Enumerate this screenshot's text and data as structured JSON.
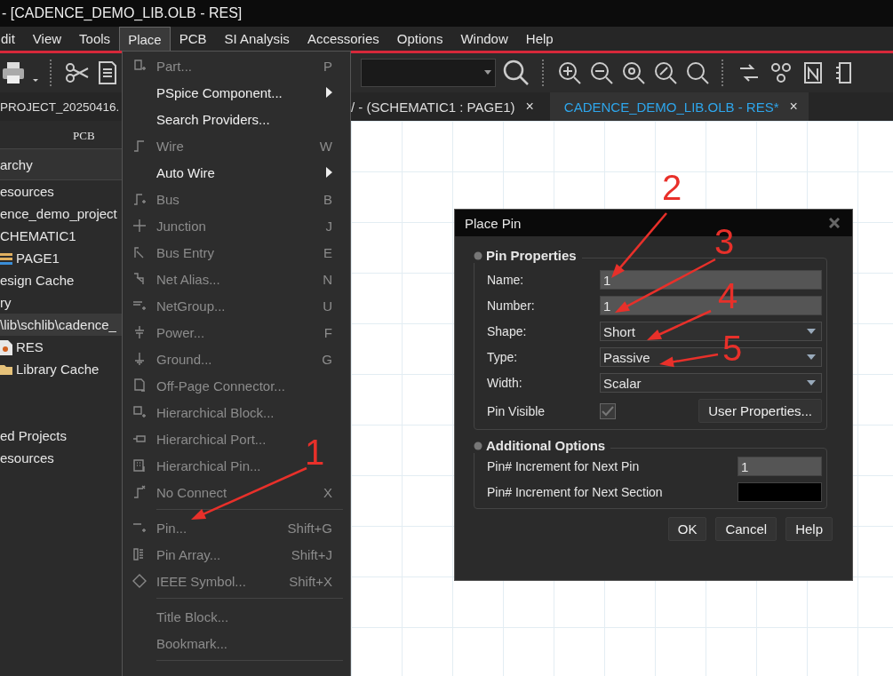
{
  "window": {
    "title": "- [CADENCE_DEMO_LIB.OLB - RES]"
  },
  "menu_bar": [
    {
      "label": "dit",
      "selected": false
    },
    {
      "label": "View",
      "selected": false
    },
    {
      "label": "Tools",
      "selected": false
    },
    {
      "label": "Place",
      "selected": true
    },
    {
      "label": "PCB",
      "selected": false
    },
    {
      "label": "SI Analysis",
      "selected": false
    },
    {
      "label": "Accessories",
      "selected": false
    },
    {
      "label": "Options",
      "selected": false
    },
    {
      "label": "Window",
      "selected": false
    },
    {
      "label": "Help",
      "selected": false
    }
  ],
  "tabs": [
    {
      "label": "PROJECT_20250416.",
      "selected": false
    },
    {
      "label": "/ - (SCHEMATIC1 : PAGE1)",
      "close": "×",
      "selected": false
    },
    {
      "label": "CADENCE_DEMO_LIB.OLB - RES*",
      "close": "×",
      "selected": true
    }
  ],
  "project_panel": {
    "tab": "PCB",
    "header": "archy",
    "sections": [
      {
        "items": [
          {
            "label": "esources",
            "kind": "text",
            "selected": false
          },
          {
            "label": "ence_demo_project",
            "kind": "text",
            "selected": false
          },
          {
            "label": "CHEMATIC1",
            "kind": "text",
            "selected": false
          },
          {
            "label": "PAGE1",
            "kind": "page",
            "selected": false
          },
          {
            "label": "esign Cache",
            "kind": "text",
            "selected": false
          },
          {
            "label": "ry",
            "kind": "text",
            "selected": false
          },
          {
            "label": "\\lib\\schlib\\cadence_",
            "kind": "text",
            "selected": true
          },
          {
            "label": "RES",
            "kind": "part",
            "selected": false
          },
          {
            "label": "Library Cache",
            "kind": "folder",
            "selected": false
          }
        ]
      },
      {
        "items": [
          {
            "label": "ed Projects",
            "kind": "text",
            "selected": false
          },
          {
            "label": "esources",
            "kind": "text",
            "selected": false
          }
        ]
      }
    ]
  },
  "place_menu": {
    "items": [
      {
        "kind": "item",
        "label": "Part...",
        "shortcut": "P",
        "disabled": true,
        "submenu": false
      },
      {
        "kind": "item",
        "label": "PSpice Component...",
        "disabled": false,
        "submenu": true
      },
      {
        "kind": "item",
        "label": "Search Providers...",
        "disabled": false,
        "submenu": false
      },
      {
        "kind": "item",
        "label": "Wire",
        "shortcut": "W",
        "disabled": true,
        "submenu": false
      },
      {
        "kind": "item",
        "label": "Auto Wire",
        "disabled": false,
        "submenu": true
      },
      {
        "kind": "item",
        "label": "Bus",
        "shortcut": "B",
        "disabled": true,
        "submenu": false
      },
      {
        "kind": "item",
        "label": "Junction",
        "shortcut": "J",
        "disabled": true,
        "submenu": false
      },
      {
        "kind": "item",
        "label": "Bus Entry",
        "shortcut": "E",
        "disabled": true,
        "submenu": false
      },
      {
        "kind": "item",
        "label": "Net Alias...",
        "shortcut": "N",
        "disabled": true,
        "submenu": false
      },
      {
        "kind": "item",
        "label": "NetGroup...",
        "shortcut": "U",
        "disabled": true,
        "submenu": false
      },
      {
        "kind": "item",
        "label": "Power...",
        "shortcut": "F",
        "disabled": true,
        "submenu": false
      },
      {
        "kind": "item",
        "label": "Ground...",
        "shortcut": "G",
        "disabled": true,
        "submenu": false
      },
      {
        "kind": "item",
        "label": "Off-Page Connector...",
        "disabled": true,
        "submenu": false
      },
      {
        "kind": "item",
        "label": "Hierarchical Block...",
        "disabled": true,
        "submenu": false
      },
      {
        "kind": "item",
        "label": "Hierarchical Port...",
        "disabled": true,
        "submenu": false
      },
      {
        "kind": "item",
        "label": "Hierarchical Pin...",
        "disabled": true,
        "submenu": false
      },
      {
        "kind": "item",
        "label": "No Connect",
        "shortcut": "X",
        "disabled": true,
        "submenu": false
      },
      {
        "kind": "separator"
      },
      {
        "kind": "item",
        "label": "Pin...",
        "shortcut": "Shift+G",
        "disabled": true,
        "submenu": false
      },
      {
        "kind": "item",
        "label": "Pin Array...",
        "shortcut": "Shift+J",
        "disabled": true,
        "submenu": false
      },
      {
        "kind": "item",
        "label": "IEEE Symbol...",
        "shortcut": "Shift+X",
        "disabled": true,
        "submenu": false
      },
      {
        "kind": "separator"
      },
      {
        "kind": "item",
        "label": "Title Block...",
        "disabled": true,
        "submenu": false
      },
      {
        "kind": "item",
        "label": "Bookmark...",
        "disabled": true,
        "submenu": false
      },
      {
        "kind": "separator"
      }
    ]
  },
  "place_pin_dialog": {
    "title": "Place Pin",
    "groups": [
      {
        "title": "Pin Properties",
        "rows": [
          {
            "label": "Name:",
            "kind": "text",
            "value": "1"
          },
          {
            "label": "Number:",
            "kind": "text",
            "value": "1"
          },
          {
            "label": "Shape:",
            "kind": "select",
            "value": "Short"
          },
          {
            "label": "Type:",
            "kind": "select",
            "value": "Passive"
          },
          {
            "label": "Width:",
            "kind": "select",
            "value": "Scalar"
          },
          {
            "label": "Pin Visible",
            "kind": "checkbox",
            "checked": true,
            "disabled": true,
            "button": "User Properties..."
          }
        ]
      },
      {
        "title": "Additional Options",
        "rows": [
          {
            "label": "Pin# Increment for Next Pin",
            "kind": "text",
            "value": "1"
          },
          {
            "label": "Pin# Increment for Next Section",
            "kind": "text"
          }
        ]
      }
    ],
    "buttons": [
      "OK",
      "Cancel",
      "Help"
    ]
  },
  "annotations": [
    "1",
    "2",
    "3",
    "4",
    "5"
  ]
}
